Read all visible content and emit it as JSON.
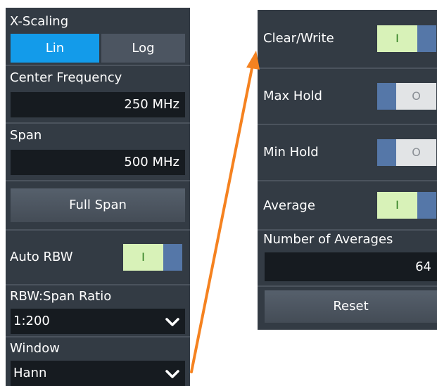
{
  "left": {
    "xscaling_label": "X-Scaling",
    "lin_label": "Lin",
    "log_label": "Log",
    "center_freq_label": "Center Frequency",
    "center_freq_value": "250 MHz",
    "span_label": "Span",
    "span_value": "500 MHz",
    "full_span_label": "Full Span",
    "auto_rbw_label": "Auto RBW",
    "auto_rbw_state": "I",
    "rbw_ratio_label": "RBW:Span Ratio",
    "rbw_ratio_value": "1:200",
    "window_label": "Window",
    "window_value": "Hann"
  },
  "right": {
    "clear_write_label": "Clear/Write",
    "clear_write_state": "I",
    "max_hold_label": "Max Hold",
    "max_hold_state": "O",
    "min_hold_label": "Min Hold",
    "min_hold_state": "O",
    "average_label": "Average",
    "average_state": "I",
    "num_averages_label": "Number of Averages",
    "num_averages_value": "64",
    "reset_label": "Reset"
  },
  "colors": {
    "panel_bg": "#333b44",
    "active_button": "#139bea",
    "toggle_on": "#d8f2b8",
    "toggle_knob": "#5577a8",
    "arrow": "#f58220"
  }
}
